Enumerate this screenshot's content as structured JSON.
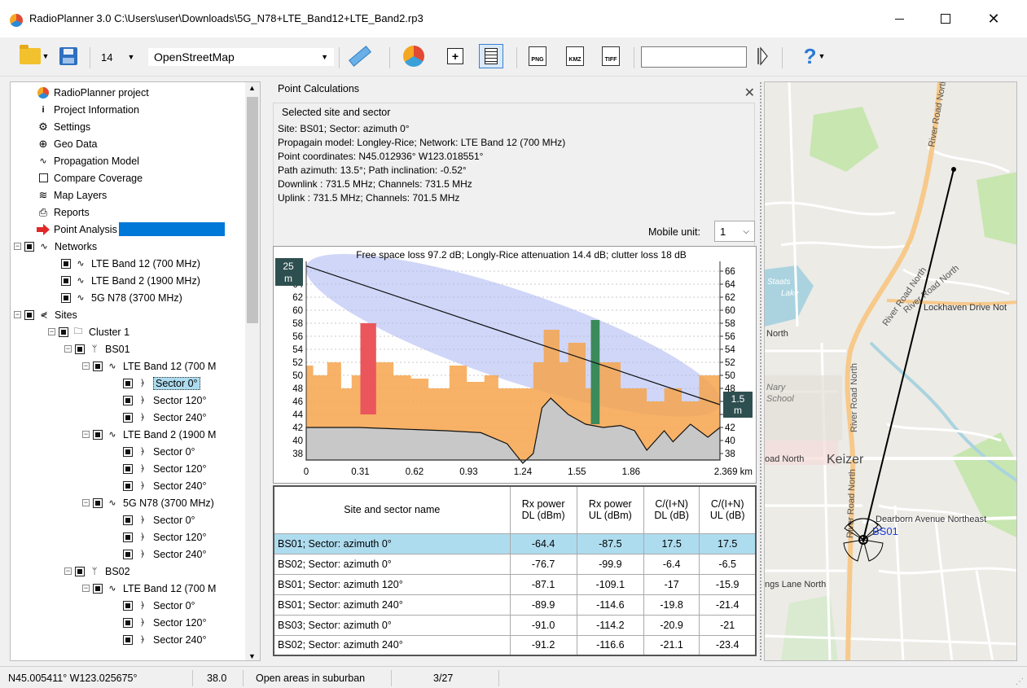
{
  "window": {
    "title": "RadioPlanner 3.0 C:\\Users\\user\\Downloads\\5G_N78+LTE_Band12+LTE_Band2.rp3",
    "close_glyph": "✕"
  },
  "toolbar": {
    "zoom_value": "14",
    "map_source": "OpenStreetMap",
    "search_value": "",
    "help_label": "?",
    "png_label": "PNG",
    "kmz_label": "KMZ",
    "tiff_label": "TIFF"
  },
  "tree": {
    "root": "RadioPlanner project",
    "items": [
      "Project Information",
      "Settings",
      "Geo Data",
      "Propagation Model",
      "Compare Coverage",
      "Map Layers",
      "Reports",
      "Point Analysis"
    ],
    "networks_label": "Networks",
    "networks": [
      "LTE Band 12 (700 MHz)",
      "LTE Band 2 (1900 MHz)",
      "5G N78 (3700 MHz)"
    ],
    "sites_label": "Sites",
    "cluster_label": "Cluster 1",
    "site1": "BS01",
    "site2": "BS02",
    "band12_short": "LTE Band 12 (700 M",
    "band2_short": "LTE Band 2 (1900 M",
    "n78_short": "5G N78 (3700 MHz)",
    "sectors": [
      "Sector 0°",
      "Sector 120°",
      "Sector 240°"
    ]
  },
  "point_calc": {
    "title": "Point Calculations",
    "group_title": "Selected site and sector",
    "lines": [
      "Site: BS01; Sector: azimuth 0°",
      "Propagain model: Longley-Rice; Network: LTE Band 12 (700 MHz)",
      "Point coordinates: N45.012936°  W123.018551°",
      "Path azimuth: 13.5°; Path inclination: -0.52°",
      "Downlink : 731.5 MHz; Channels: 731.5 MHz",
      "Uplink : 731.5 MHz; Channels: 701.5 MHz"
    ],
    "mobile_unit_label": "Mobile unit:",
    "mobile_unit_value": "1"
  },
  "chart_data": {
    "type": "area",
    "title": "Free space loss 97.2 dB; Longly-Rice attenuation 14.4 dB; clutter loss 18 dB",
    "x_ticks": [
      "0",
      "0.31",
      "0.62",
      "0.93",
      "1.24",
      "1.55",
      "1.86",
      "2.369 km"
    ],
    "y_ticks": [
      "38",
      "40",
      "42",
      "44",
      "46",
      "48",
      "50",
      "52",
      "54",
      "56",
      "58",
      "60",
      "62",
      "64",
      "66"
    ],
    "ylim": [
      37,
      67
    ],
    "xlim": [
      0,
      2.369
    ],
    "tx_height_label": "25",
    "tx_height_unit": "m",
    "rx_height_label": "1.5",
    "rx_height_unit": "m",
    "terrain": {
      "x": [
        0,
        0.1,
        0.3,
        0.5,
        0.8,
        1.0,
        1.15,
        1.24,
        1.3,
        1.35,
        1.4,
        1.5,
        1.6,
        1.7,
        1.8,
        1.88,
        1.95,
        2.05,
        2.1,
        2.2,
        2.3,
        2.369
      ],
      "y": [
        42,
        42,
        42,
        41.8,
        41.5,
        41.2,
        39.5,
        36.5,
        38,
        45,
        46.5,
        44,
        42.5,
        42,
        42.3,
        41.5,
        38.5,
        41.5,
        39.8,
        42.5,
        40.5,
        42
      ]
    },
    "clutter": {
      "x": [
        0,
        0.04,
        0.04,
        0.12,
        0.12,
        0.2,
        0.2,
        0.26,
        0.26,
        0.31,
        0.31,
        0.4,
        0.4,
        0.5,
        0.5,
        0.6,
        0.6,
        0.7,
        0.7,
        0.82,
        0.82,
        0.92,
        0.92,
        1.02,
        1.02,
        1.1,
        1.1,
        1.2,
        1.3,
        1.3,
        1.36,
        1.36,
        1.45,
        1.45,
        1.5,
        1.5,
        1.6,
        1.6,
        1.68,
        1.68,
        1.8,
        1.8,
        1.95,
        1.95,
        2.05,
        2.05,
        2.15,
        2.15,
        2.25,
        2.25,
        2.369
      ],
      "y": [
        51.5,
        51.5,
        50,
        50,
        52,
        52,
        48,
        48,
        50,
        50,
        58,
        58,
        52,
        52,
        50,
        50,
        49.5,
        49.5,
        48,
        48,
        51.5,
        51.5,
        49,
        49,
        50,
        50,
        48,
        48,
        48,
        52,
        52,
        57,
        57,
        52,
        52,
        55,
        55,
        48,
        48,
        52,
        52,
        48,
        48,
        46,
        46,
        48,
        48,
        46,
        46,
        50,
        50
      ]
    },
    "vegetation_peak": {
      "x": [
        1.63,
        1.68
      ],
      "top": 58.5
    },
    "los": {
      "x": [
        0,
        2.369
      ],
      "y": [
        66.8,
        45.5
      ]
    }
  },
  "results_table": {
    "headers": [
      "Site and sector name",
      "Rx power\nDL (dBm)",
      "Rx power\nUL (dBm)",
      "C/(I+N)\nDL (dB)",
      "C/(I+N)\nUL (dB)"
    ],
    "rows": [
      [
        "BS01; Sector: azimuth 0°",
        "-64.4",
        "-87.5",
        "17.5",
        "17.5"
      ],
      [
        "BS02; Sector: azimuth 0°",
        "-76.7",
        "-99.9",
        "-6.4",
        "-6.5"
      ],
      [
        "BS01; Sector: azimuth 120°",
        "-87.1",
        "-109.1",
        "-17",
        "-15.9"
      ],
      [
        "BS01; Sector: azimuth 240°",
        "-89.9",
        "-114.6",
        "-19.8",
        "-21.4"
      ],
      [
        "BS03; Sector: azimuth 0°",
        "-91.0",
        "-114.2",
        "-20.9",
        "-21"
      ],
      [
        "BS02; Sector: azimuth 240°",
        "-91.2",
        "-116.6",
        "-21.1",
        "-23.4"
      ]
    ]
  },
  "map": {
    "labels": {
      "river_road_north": "River Road North",
      "staats_lake": "Staats\nLake",
      "lockhaven": "Lockhaven Drive Not",
      "north": "North",
      "school": "Nary\nSchool",
      "road_north": "oad North",
      "keizer": "Keizer",
      "dearborn": "Dearborn Avenue Northeast",
      "site": "BS01",
      "lane": "ngs Lane North"
    },
    "colors": {
      "major_road": "#f7c98a",
      "water": "#aad3df",
      "park": "#c8e6b0",
      "urban": "#e0dfd8"
    }
  },
  "status": {
    "coords": "N45.005411°  W123.025675°",
    "elevation": "38.0",
    "clutter": "Open areas in suburban",
    "page": "3/27"
  }
}
